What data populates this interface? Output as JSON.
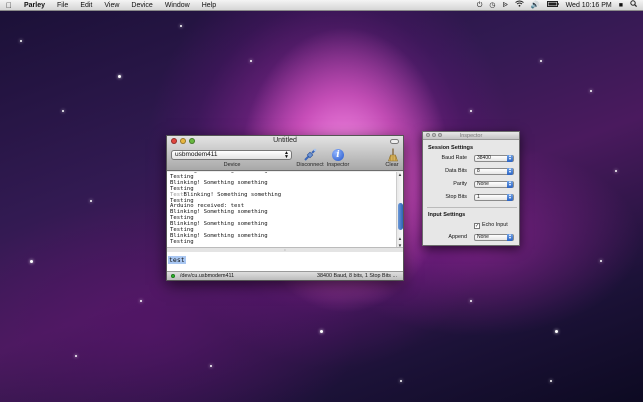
{
  "menubar": {
    "apple_icon": "apple-logo",
    "app_name": "Parley",
    "items": [
      "File",
      "Edit",
      "View",
      "Device",
      "Window",
      "Help"
    ],
    "clock": "Wed 10:16 PM",
    "status_icons": [
      "power-icon",
      "time-machine-icon",
      "bluetooth-icon",
      "wifi-icon",
      "volume-icon",
      "battery-icon",
      "user-icon",
      "spotlight-icon"
    ]
  },
  "window": {
    "title": "Untitled",
    "device_value": "usbmodem411",
    "device_label": "Device",
    "disconnect_label": "Disconnect",
    "inspector_label": "Inspector",
    "clear_label": "Clear",
    "console_lines": [
      {
        "text": "Blinking! Something something",
        "dim": false
      },
      {
        "text": "Testing",
        "dim": false
      },
      {
        "text": "Blinking! Something something",
        "dim": false
      },
      {
        "text": "Testing",
        "dim": false
      },
      {
        "prefix": "Test",
        "text": "Blinking! Something something",
        "dim": false
      },
      {
        "text": "Testing",
        "dim": false
      },
      {
        "text": "Arduino received: test",
        "dim": false
      },
      {
        "text": "Blinking! Something something",
        "dim": false
      },
      {
        "text": "Testing",
        "dim": false
      },
      {
        "text": "Blinking! Something something",
        "dim": false
      },
      {
        "text": "Testing",
        "dim": false
      },
      {
        "text": "Blinking! Something something",
        "dim": false
      },
      {
        "text": "Testing",
        "dim": false
      }
    ],
    "input_value": "test",
    "status_port": "/dev/cu.usbmodem411",
    "status_config": "38400 Baud, 8 bits, 1 Stop Bits ...",
    "status_color": "#2fbf2f"
  },
  "inspector": {
    "title": "Inspector",
    "session_title": "Session Settings",
    "baud_label": "Baud Rate",
    "baud_value": "38400",
    "data_bits_label": "Data Bits",
    "data_bits_value": "8",
    "parity_label": "Parity",
    "parity_value": "None",
    "stop_bits_label": "Stop Bits",
    "stop_bits_value": "1",
    "input_title": "Input Settings",
    "echo_label": "Echo Input",
    "echo_checked": true,
    "append_label": "Append",
    "append_value": "None"
  },
  "colors": {
    "accent": "#2a63c4",
    "close": "#e0463f",
    "minimize": "#e7b640",
    "maximize": "#68b840"
  }
}
